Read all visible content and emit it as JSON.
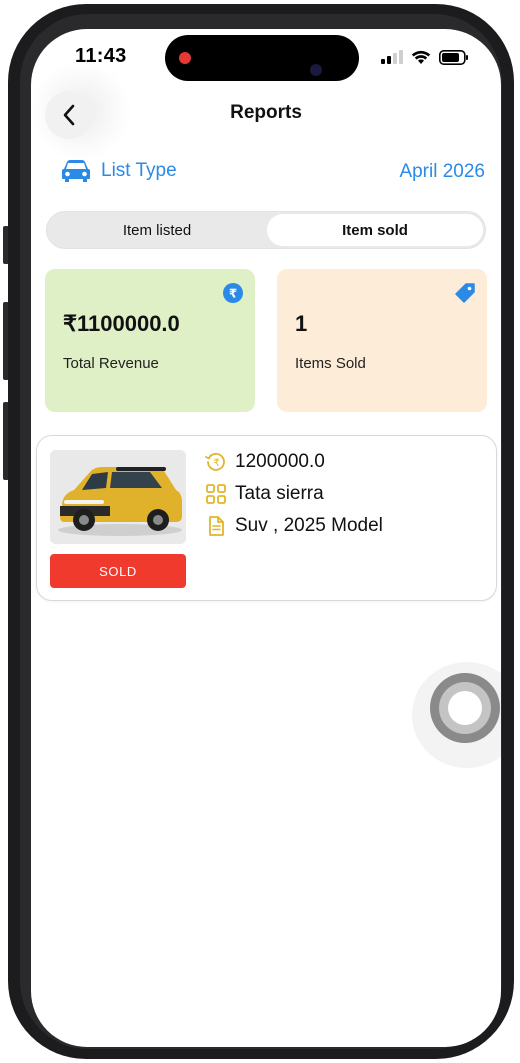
{
  "status_bar": {
    "time": "11:43"
  },
  "header": {
    "title": "Reports"
  },
  "filters": {
    "list_type_label": "List Type",
    "month_label": "April 2026"
  },
  "segment": {
    "tabs": [
      {
        "label": "Item listed"
      },
      {
        "label": "Item sold"
      }
    ],
    "selected": "Item sold"
  },
  "stats": {
    "revenue": {
      "value": "₹1100000.0",
      "label": "Total Revenue",
      "icon": "rupee-icon",
      "color": "#dff0c7"
    },
    "sold": {
      "value": "1",
      "label": "Items Sold",
      "icon": "tag-icon",
      "color": "#fdecd8"
    }
  },
  "listing": {
    "price": "1200000.0",
    "name": "Tata sierra",
    "details": "Suv , 2025 Model",
    "status_label": "SOLD",
    "status_color": "#f03a2e"
  },
  "colors": {
    "accent": "#2b8ae6",
    "icon_gold": "#e0b62a"
  }
}
